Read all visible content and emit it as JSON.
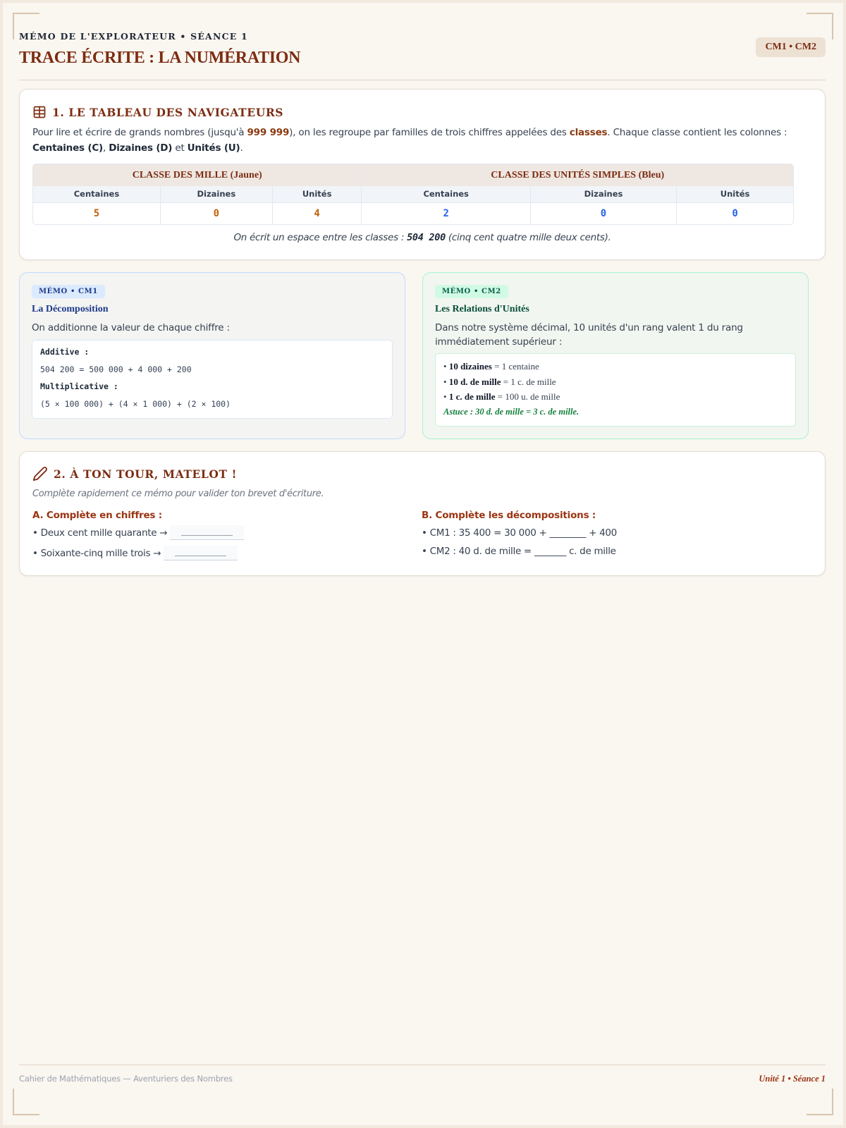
{
  "header": {
    "kicker": "MÉMO DE L'EXPLORATEUR • SÉANCE 1",
    "title": "TRACE ÉCRITE : LA NUMÉRATION",
    "level_badge": "CM1 • CM2"
  },
  "section1": {
    "title": "1. LE TABLEAU DES NAVIGATEURS",
    "intro": {
      "t1": "Pour lire et écrire de grands nombres (jusqu'à ",
      "max": "999 999",
      "t2": "), on les regroupe par familles de trois chiffres appelées des ",
      "classes": "classes",
      "t3": ". Chaque classe contient les colonnes : ",
      "c": "Centaines (C)",
      "sep": ", ",
      "d": "Dizaines (D)",
      "and": " et ",
      "u": "Unités (U)",
      "end": "."
    },
    "table": {
      "class_mille": "CLASSE DES MILLE (Jaune)",
      "class_units": "CLASSE DES UNITÉS SIMPLES (Bleu)",
      "columns": [
        "Centaines",
        "Dizaines",
        "Unités",
        "Centaines",
        "Dizaines",
        "Unités"
      ],
      "values": [
        "5",
        "0",
        "4",
        "2",
        "0",
        "0"
      ]
    },
    "note": {
      "before": "On écrit un espace entre les classes : ",
      "number": "504 200",
      "after": " (cinq cent quatre mille deux cents)."
    }
  },
  "memo_cm1": {
    "badge": "MÉMO • CM1",
    "title": "La Décomposition",
    "text": "On additionne la valeur de chaque chiffre :",
    "additive_label": "Additive :",
    "additive": "504 200 = 500 000 + 4 000 + 200",
    "multiplicative_label": "Multiplicative :",
    "multiplicative": "(5 × 100 000) + (4 × 1 000) + (2 × 100)"
  },
  "memo_cm2": {
    "badge": "MÉMO • CM2",
    "title": "Les Relations d'Unités",
    "text": "Dans notre système décimal, 10 unités d'un rang valent 1 du rang immédiatement supérieur :",
    "relations": [
      {
        "bold": "10 dizaines",
        "rest": " = 1 centaine"
      },
      {
        "bold": "10 d. de mille",
        "rest": " = 1 c. de mille"
      },
      {
        "bold": "1 c. de mille",
        "rest": " = 100 u. de mille"
      }
    ],
    "tip": "Astuce : 30 d. de mille = 3 c. de mille."
  },
  "section2": {
    "title": "2. À TON TOUR, MATELOT !",
    "subtitle": "Complète rapidement ce mémo pour valider ton brevet d'écriture.",
    "part_a": {
      "heading": "A. Complète en chiffres :",
      "items": [
        "• Deux cent mille quarante →",
        "• Soixante-cinq mille trois →"
      ]
    },
    "part_b": {
      "heading": "B. Complète les décompositions :",
      "items": [
        "• CM1 : 35 400 = 30 000 + ________ + 400",
        "• CM2 : 40 d. de mille = _______ c. de mille"
      ]
    }
  },
  "footer": {
    "left": "Cahier de Mathématiques — Aventuriers des Nombres",
    "right": "Unité 1 • Séance 1"
  },
  "colors": {
    "accent": "#7c2d12",
    "mille_digit": "#c2620a",
    "unit_digit": "#2563eb",
    "cm1_border": "#bfdbfe",
    "cm2_border": "#a7f3d0"
  }
}
